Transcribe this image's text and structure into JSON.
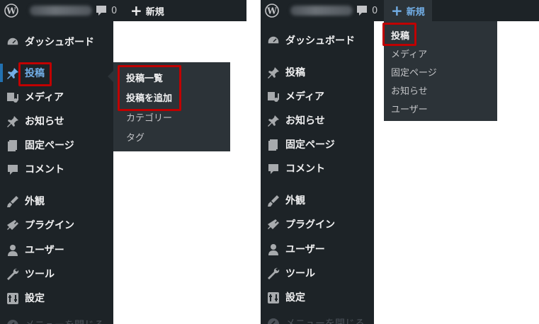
{
  "admin_bar": {
    "comment_count": "0",
    "new_label": "新規",
    "site_name_redacted": true
  },
  "left_panel": {
    "menu": [
      {
        "label": "ダッシュボード",
        "icon": "dashboard-icon"
      },
      {
        "label": "投稿",
        "icon": "pin-icon",
        "current": true
      },
      {
        "label": "メディア",
        "icon": "media-icon"
      },
      {
        "label": "お知らせ",
        "icon": "pin-icon"
      },
      {
        "label": "固定ページ",
        "icon": "page-icon"
      },
      {
        "label": "コメント",
        "icon": "comment-icon"
      },
      {
        "label": "外観",
        "icon": "brush-icon"
      },
      {
        "label": "プラグイン",
        "icon": "plugin-icon"
      },
      {
        "label": "ユーザー",
        "icon": "user-icon"
      },
      {
        "label": "ツール",
        "icon": "wrench-icon"
      },
      {
        "label": "設定",
        "icon": "settings-icon"
      },
      {
        "label": "メニューを閉じる",
        "icon": "collapse-icon"
      }
    ],
    "flyout": [
      "投稿一覧",
      "投稿を追加",
      "カテゴリー",
      "タグ"
    ]
  },
  "right_panel": {
    "menu": [
      {
        "label": "ダッシュボード",
        "icon": "dashboard-icon"
      },
      {
        "label": "投稿",
        "icon": "pin-icon"
      },
      {
        "label": "メディア",
        "icon": "media-icon"
      },
      {
        "label": "お知らせ",
        "icon": "pin-icon"
      },
      {
        "label": "固定ページ",
        "icon": "page-icon"
      },
      {
        "label": "コメント",
        "icon": "comment-icon"
      },
      {
        "label": "外観",
        "icon": "brush-icon"
      },
      {
        "label": "プラグイン",
        "icon": "plugin-icon"
      },
      {
        "label": "ユーザー",
        "icon": "user-icon"
      },
      {
        "label": "ツール",
        "icon": "wrench-icon"
      },
      {
        "label": "設定",
        "icon": "settings-icon"
      },
      {
        "label": "メニューを閉じる",
        "icon": "collapse-icon"
      }
    ],
    "new_dropdown": [
      "投稿",
      "メディア",
      "固定ページ",
      "お知らせ",
      "ユーザー"
    ]
  },
  "colors": {
    "admin_bg": "#1d2327",
    "submenu_bg": "#2c3338",
    "text": "#f0f0f1",
    "accent": "#72aee6",
    "highlight_box": "#c00000"
  }
}
